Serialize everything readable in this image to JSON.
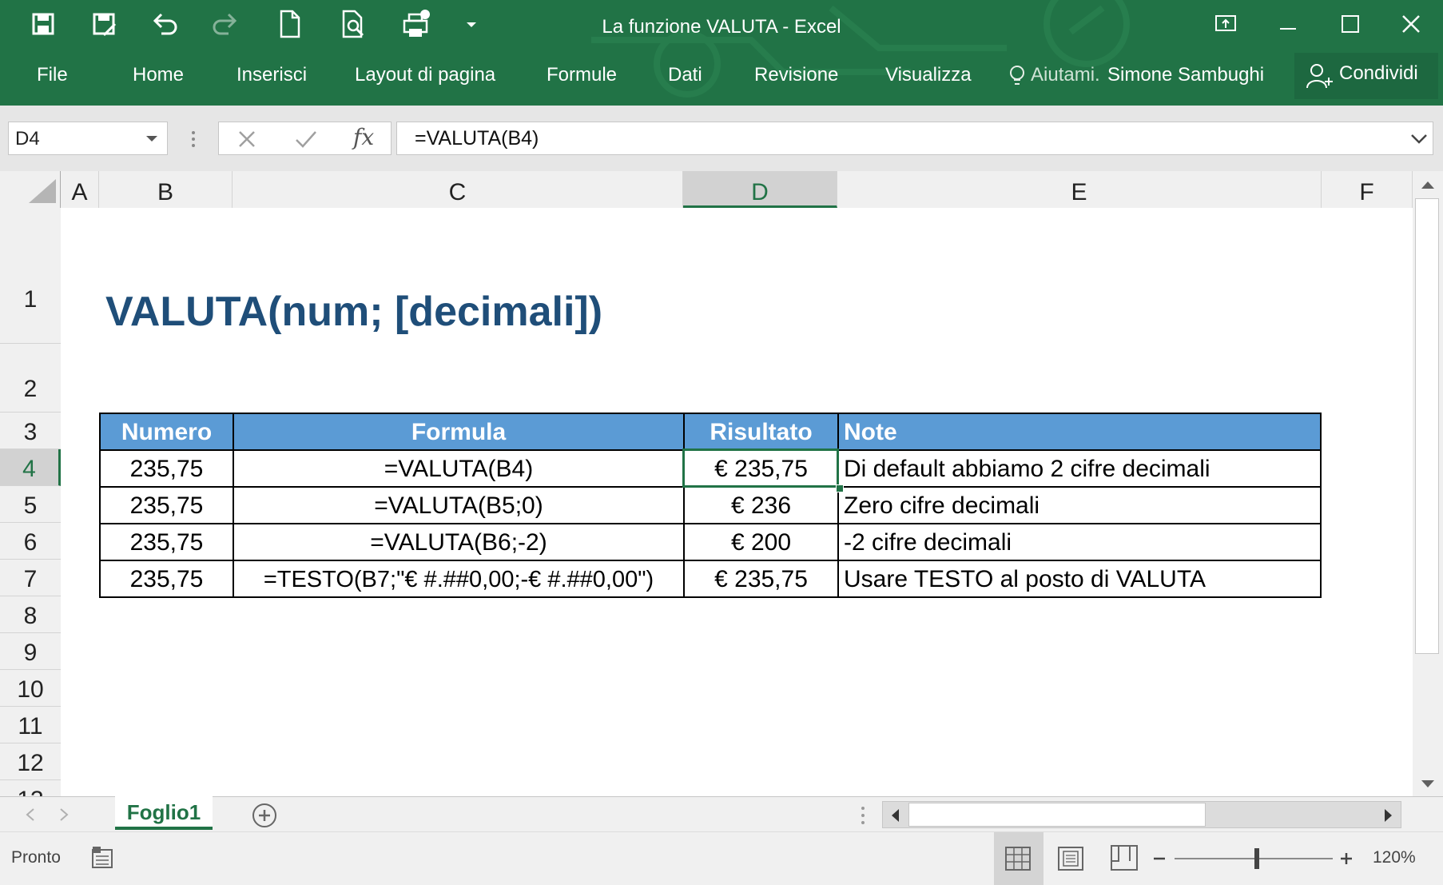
{
  "window": {
    "title": "La funzione VALUTA - Excel"
  },
  "ribbon": {
    "tabs": [
      "File",
      "Home",
      "Inserisci",
      "Layout di pagina",
      "Formule",
      "Dati",
      "Revisione",
      "Visualizza"
    ],
    "tell_me": "Aiutami.",
    "user": "Simone Sambughi",
    "share": "Condividi"
  },
  "formula_bar": {
    "name_box": "D4",
    "fx": "fx",
    "formula": "=VALUTA(B4)"
  },
  "columns": [
    "A",
    "B",
    "C",
    "D",
    "E",
    "F"
  ],
  "rows": [
    "1",
    "2",
    "3",
    "4",
    "5",
    "6",
    "7",
    "8",
    "9",
    "10",
    "11",
    "12",
    "13"
  ],
  "sheet": {
    "title": "VALUTA(num; [decimali])",
    "headers": [
      "Numero",
      "Formula",
      "Risultato",
      "Note"
    ],
    "table": [
      {
        "numero": "235,75",
        "formula": "=VALUTA(B4)",
        "risultato": "€ 235,75",
        "note": "Di default abbiamo 2 cifre decimali"
      },
      {
        "numero": "235,75",
        "formula": "=VALUTA(B5;0)",
        "risultato": "€ 236",
        "note": "Zero cifre decimali"
      },
      {
        "numero": "235,75",
        "formula": "=VALUTA(B6;-2)",
        "risultato": "€ 200",
        "note": "-2 cifre decimali"
      },
      {
        "numero": "235,75",
        "formula": "=TESTO(B7;\"€ #.##0,00;-€ #.##0,00\")",
        "risultato": "€ 235,75",
        "note": "Usare TESTO al posto di VALUTA"
      }
    ]
  },
  "tabs": {
    "sheet1": "Foglio1"
  },
  "status": {
    "ready": "Pronto",
    "zoom": "120%"
  },
  "colors": {
    "excel_green": "#217346",
    "header_blue": "#5b9bd5",
    "title_blue": "#1f4e79"
  }
}
